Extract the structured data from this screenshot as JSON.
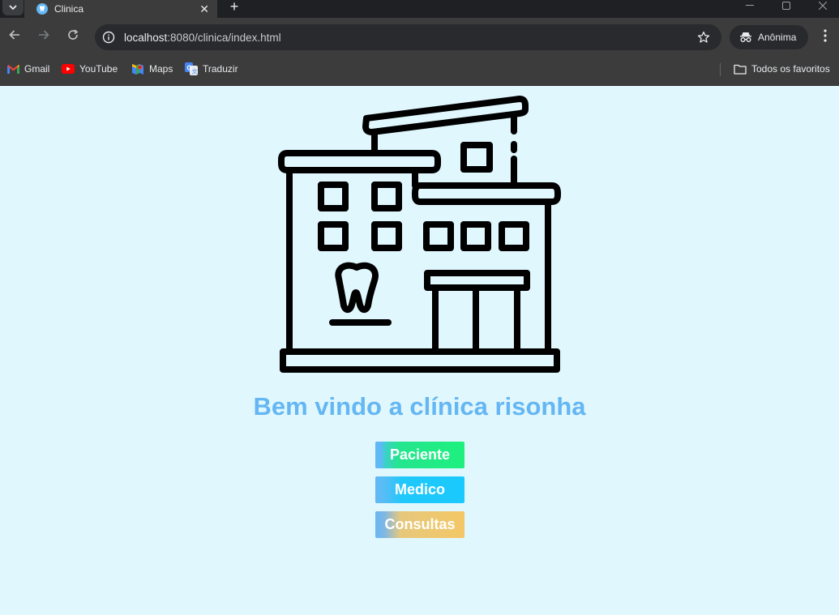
{
  "browser": {
    "tab_title": "Clinica",
    "url_host": "localhost",
    "url_rest": ":8080/clinica/index.html",
    "profile_label": "Anônima",
    "bookmarks": [
      {
        "label": "Gmail",
        "icon": "gmail-icon"
      },
      {
        "label": "YouTube",
        "icon": "youtube-icon"
      },
      {
        "label": "Maps",
        "icon": "maps-icon"
      },
      {
        "label": "Traduzir",
        "icon": "translate-icon"
      }
    ],
    "all_bookmarks_label": "Todos os favoritos"
  },
  "page": {
    "title": "Bem vindo a clínica risonha",
    "title_color": "#64b7f3",
    "background": "#e1f7fe",
    "illustration": "dental-clinic-building-icon",
    "buttons": {
      "paciente": "Paciente",
      "medico": "Medico",
      "consultas": "Consultas"
    }
  }
}
